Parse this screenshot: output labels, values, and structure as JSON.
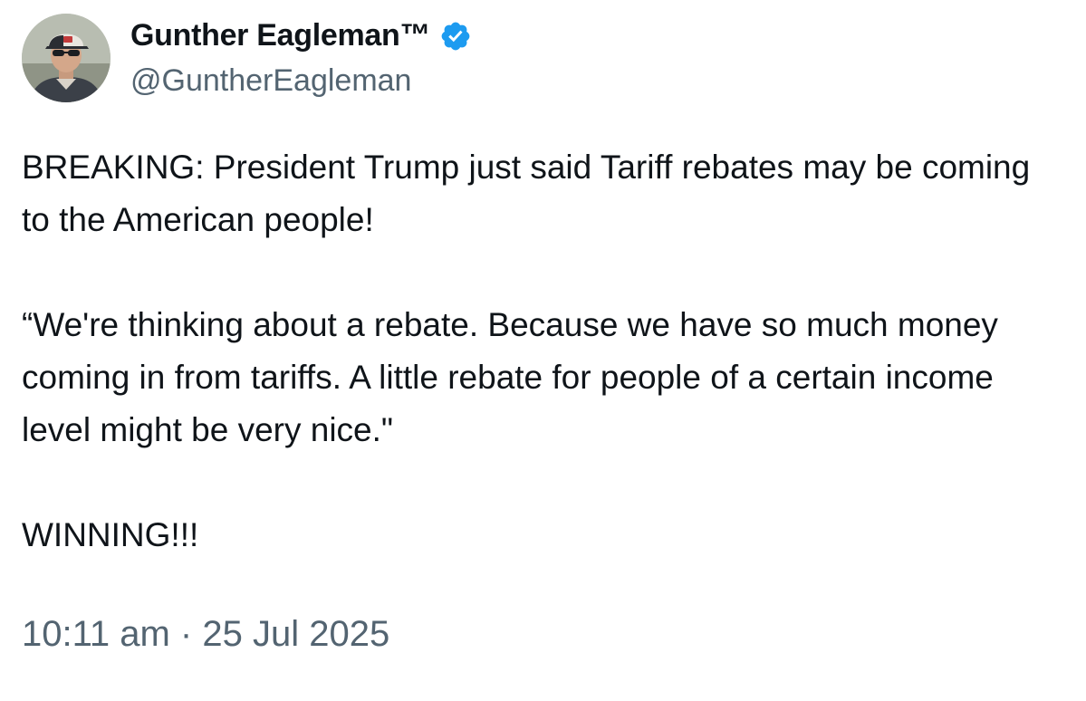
{
  "author": {
    "display_name": "Gunther Eagleman™",
    "handle": "@GuntherEagleman",
    "verified_icon": "verified-badge-icon",
    "verified_color": "#1d9bf0"
  },
  "tweet": {
    "paragraphs": [
      "BREAKING: President Trump just said Tariff rebates may be coming to the American people!",
      "“We're thinking about a rebate. Because we have so much money coming in from tariffs. A little rebate for people of a certain income level might be very nice.\"",
      "WINNING!!!"
    ],
    "timestamp": "10:11 am · 25 Jul 2025"
  },
  "colors": {
    "text": "#0f1419",
    "secondary": "#536471",
    "background": "#ffffff"
  }
}
